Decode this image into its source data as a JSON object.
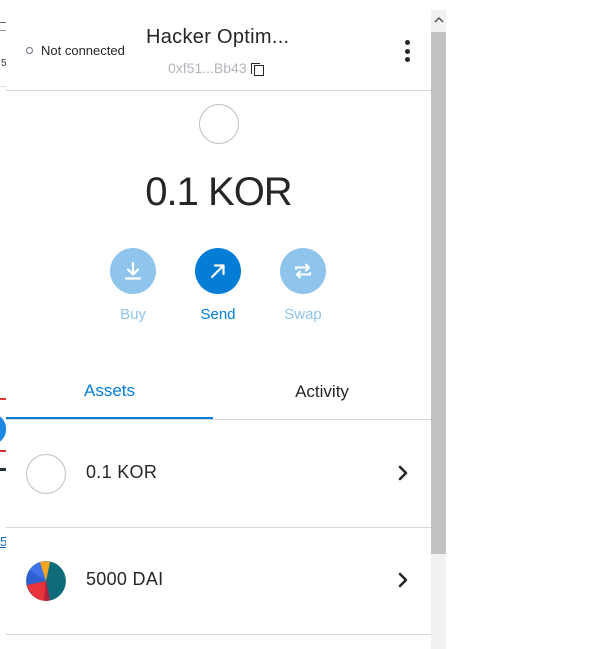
{
  "background_page": {
    "fragment_char": "5"
  },
  "header": {
    "connection_status": "Not connected",
    "account_name": "Hacker Optim...",
    "account_address": "0xf51...Bb43",
    "menu_icon": "kebab-menu-icon",
    "copy_icon": "copy-icon"
  },
  "overview": {
    "balance": "0.1 KOR",
    "actions": {
      "buy": "Buy",
      "send": "Send",
      "swap": "Swap"
    }
  },
  "tabs": {
    "assets": "Assets",
    "activity": "Activity"
  },
  "assets": [
    {
      "label": "0.1 KOR",
      "icon": "token-placeholder-icon"
    },
    {
      "label": "5000 DAI",
      "icon": "dai-token-icon"
    }
  ],
  "colors": {
    "primary_blue": "#037dd6",
    "light_blue": "#8fc4ec",
    "text": "#24272a",
    "muted": "#b0b5ba",
    "divider": "#d6d9dc"
  }
}
